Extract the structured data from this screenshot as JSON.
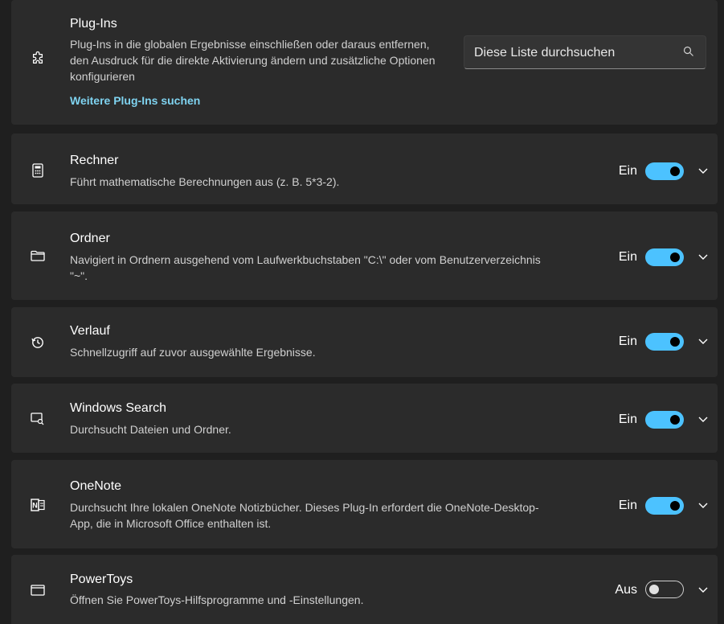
{
  "header": {
    "title": "Plug-Ins",
    "description": "Plug-Ins in die globalen Ergebnisse einschließen oder daraus entfernen, den Ausdruck für die direkte Aktivierung ändern und zusätzliche Optionen konfigurieren",
    "link": "Weitere Plug-Ins suchen",
    "icon": "puzzle-icon",
    "search_placeholder": "Diese Liste durchsuchen"
  },
  "plugins": [
    {
      "title": "Rechner",
      "description": "Führt mathematische Berechnungen aus (z. B. 5*3-2).",
      "state": "Ein",
      "enabled": true,
      "icon": "calculator-icon"
    },
    {
      "title": "Ordner",
      "description": "Navigiert in Ordnern ausgehend vom Laufwerkbuchstaben \"C:\\\" oder vom Benutzerverzeichnis \"~\".",
      "state": "Ein",
      "enabled": true,
      "icon": "folder-icon"
    },
    {
      "title": "Verlauf",
      "description": "Schnellzugriff auf zuvor ausgewählte Ergebnisse.",
      "state": "Ein",
      "enabled": true,
      "icon": "history-icon"
    },
    {
      "title": "Windows Search",
      "description": "Durchsucht Dateien und Ordner.",
      "state": "Ein",
      "enabled": true,
      "icon": "windows-search-icon"
    },
    {
      "title": "OneNote",
      "description": "Durchsucht Ihre lokalen OneNote Notizbücher. Dieses Plug-In erfordert die OneNote-Desktop-App, die in Microsoft Office enthalten ist.",
      "state": "Ein",
      "enabled": true,
      "icon": "onenote-icon"
    },
    {
      "title": "PowerToys",
      "description": "Öffnen Sie PowerToys-Hilfsprogramme und -Einstellungen.",
      "state": "Aus",
      "enabled": false,
      "icon": "window-icon"
    }
  ],
  "colors": {
    "accent": "#4cc2ff",
    "link": "#7fd3f0",
    "card": "#2b2b2b",
    "background": "#1f1f1f"
  }
}
